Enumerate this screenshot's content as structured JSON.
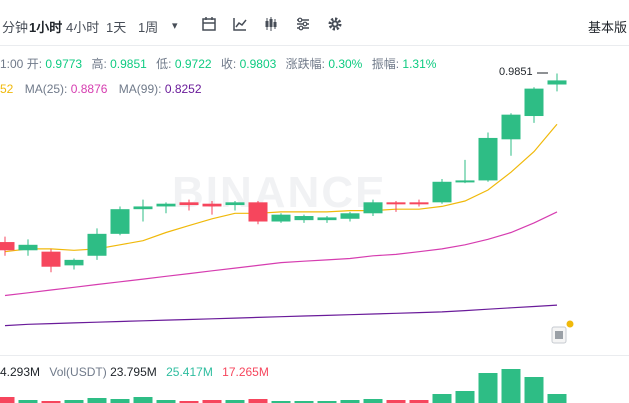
{
  "toolbar": {
    "timeframes": [
      "分钟",
      "1小时",
      "4小时",
      "1天",
      "1周"
    ],
    "active_timeframe": "1小时",
    "more": "▾",
    "basic_label": "基本版"
  },
  "ohlc": {
    "time": "1:00",
    "open_label": "开:",
    "open": "0.9773",
    "high_label": "高:",
    "high": "0.9851",
    "low_label": "低:",
    "low": "0.9722",
    "close_label": "收:",
    "close": "0.9803",
    "change_label": "涨跌幅:",
    "change": "0.30%",
    "amp_label": "振幅:",
    "amp": "1.31%"
  },
  "ma": {
    "ma7_value": "52",
    "ma25_label": "MA(25):",
    "ma25_value": "0.8876",
    "ma99_label": "MA(99):",
    "ma99_value": "0.8252",
    "colors": {
      "ma7": "#f0b90b",
      "ma25": "#d63db0",
      "ma99": "#6a1b9a"
    }
  },
  "high_marker": "0.9851",
  "watermark": "BINANCE",
  "volume": {
    "v1": "4.293M",
    "v2_label": "Vol(USDT)",
    "v2": "23.795M",
    "v3": "25.417M",
    "v4": "17.265M",
    "colors": {
      "v1": "#1e2329",
      "v2": "#1e2329",
      "v3": "#2ebd9f",
      "v4": "#f6465d"
    }
  },
  "colors": {
    "up": "#2ebd85",
    "down": "#f6465d"
  },
  "chart_data": {
    "type": "candlestick",
    "series": [
      {
        "o": 0.862,
        "h": 0.866,
        "l": 0.852,
        "c": 0.856
      },
      {
        "o": 0.856,
        "h": 0.864,
        "l": 0.852,
        "c": 0.86
      },
      {
        "o": 0.855,
        "h": 0.857,
        "l": 0.84,
        "c": 0.844
      },
      {
        "o": 0.845,
        "h": 0.85,
        "l": 0.842,
        "c": 0.849
      },
      {
        "o": 0.852,
        "h": 0.872,
        "l": 0.849,
        "c": 0.868
      },
      {
        "o": 0.868,
        "h": 0.888,
        "l": 0.867,
        "c": 0.886
      },
      {
        "o": 0.886,
        "h": 0.893,
        "l": 0.877,
        "c": 0.888
      },
      {
        "o": 0.888,
        "h": 0.891,
        "l": 0.883,
        "c": 0.89
      },
      {
        "o": 0.891,
        "h": 0.893,
        "l": 0.885,
        "c": 0.889
      },
      {
        "o": 0.89,
        "h": 0.892,
        "l": 0.882,
        "c": 0.888
      },
      {
        "o": 0.889,
        "h": 0.892,
        "l": 0.885,
        "c": 0.891
      },
      {
        "o": 0.891,
        "h": 0.892,
        "l": 0.875,
        "c": 0.877
      },
      {
        "o": 0.877,
        "h": 0.883,
        "l": 0.876,
        "c": 0.882
      },
      {
        "o": 0.878,
        "h": 0.882,
        "l": 0.876,
        "c": 0.881
      },
      {
        "o": 0.878,
        "h": 0.881,
        "l": 0.876,
        "c": 0.88
      },
      {
        "o": 0.879,
        "h": 0.884,
        "l": 0.877,
        "c": 0.883
      },
      {
        "o": 0.883,
        "h": 0.893,
        "l": 0.881,
        "c": 0.891
      },
      {
        "o": 0.891,
        "h": 0.892,
        "l": 0.884,
        "c": 0.89
      },
      {
        "o": 0.891,
        "h": 0.893,
        "l": 0.888,
        "c": 0.89
      },
      {
        "o": 0.891,
        "h": 0.908,
        "l": 0.89,
        "c": 0.906
      },
      {
        "o": 0.906,
        "h": 0.922,
        "l": 0.905,
        "c": 0.907
      },
      {
        "o": 0.907,
        "h": 0.942,
        "l": 0.906,
        "c": 0.938
      },
      {
        "o": 0.937,
        "h": 0.956,
        "l": 0.925,
        "c": 0.955
      },
      {
        "o": 0.954,
        "h": 0.975,
        "l": 0.949,
        "c": 0.974
      },
      {
        "o": 0.977,
        "h": 0.985,
        "l": 0.972,
        "c": 0.98
      }
    ],
    "ma7": [
      0.855,
      0.857,
      0.857,
      0.856,
      0.857,
      0.86,
      0.863,
      0.869,
      0.874,
      0.879,
      0.883,
      0.883,
      0.884,
      0.884,
      0.884,
      0.885,
      0.885,
      0.886,
      0.886,
      0.888,
      0.892,
      0.9,
      0.913,
      0.928,
      0.948
    ],
    "ma25": [
      0.823,
      0.825,
      0.827,
      0.829,
      0.831,
      0.833,
      0.835,
      0.837,
      0.839,
      0.841,
      0.843,
      0.845,
      0.847,
      0.848,
      0.849,
      0.85,
      0.852,
      0.853,
      0.855,
      0.857,
      0.86,
      0.864,
      0.869,
      0.876,
      0.884
    ],
    "ma99": [
      0.801,
      0.802,
      0.8025,
      0.803,
      0.8035,
      0.804,
      0.8045,
      0.805,
      0.8055,
      0.806,
      0.8065,
      0.807,
      0.8075,
      0.808,
      0.8085,
      0.809,
      0.8095,
      0.81,
      0.8105,
      0.811,
      0.812,
      0.813,
      0.814,
      0.815,
      0.816
    ],
    "volume": [
      6,
      3,
      2,
      3,
      5,
      4,
      6,
      3,
      2,
      3,
      3,
      4,
      2,
      2,
      2,
      3,
      4,
      3,
      3,
      9,
      12,
      30,
      34,
      26,
      9
    ]
  }
}
